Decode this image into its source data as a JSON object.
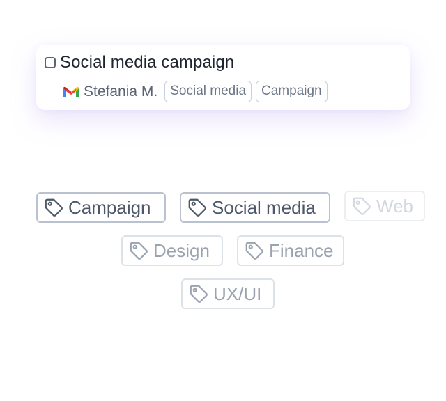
{
  "task": {
    "title": "Social media campaign",
    "assignee": "Stefania M.",
    "source_icon": "gmail-icon",
    "tags": [
      "Social media",
      "Campaign"
    ]
  },
  "tag_options": [
    {
      "label": "Campaign",
      "state": "active",
      "icon": "tag-icon"
    },
    {
      "label": "Social media",
      "state": "active",
      "icon": "tag-icon"
    },
    {
      "label": "Web",
      "state": "faint",
      "icon": "tag-icon"
    },
    {
      "label": "Design",
      "state": "dim",
      "icon": "tag-icon"
    },
    {
      "label": "Finance",
      "state": "dim",
      "icon": "tag-icon"
    },
    {
      "label": "UX/UI",
      "state": "dim",
      "icon": "tag-icon"
    }
  ],
  "colors": {
    "active_text": "#4f5868",
    "dim_text": "#9aa3b0",
    "faint_text": "#d3d8df",
    "card_shadow": "#b496f0"
  }
}
